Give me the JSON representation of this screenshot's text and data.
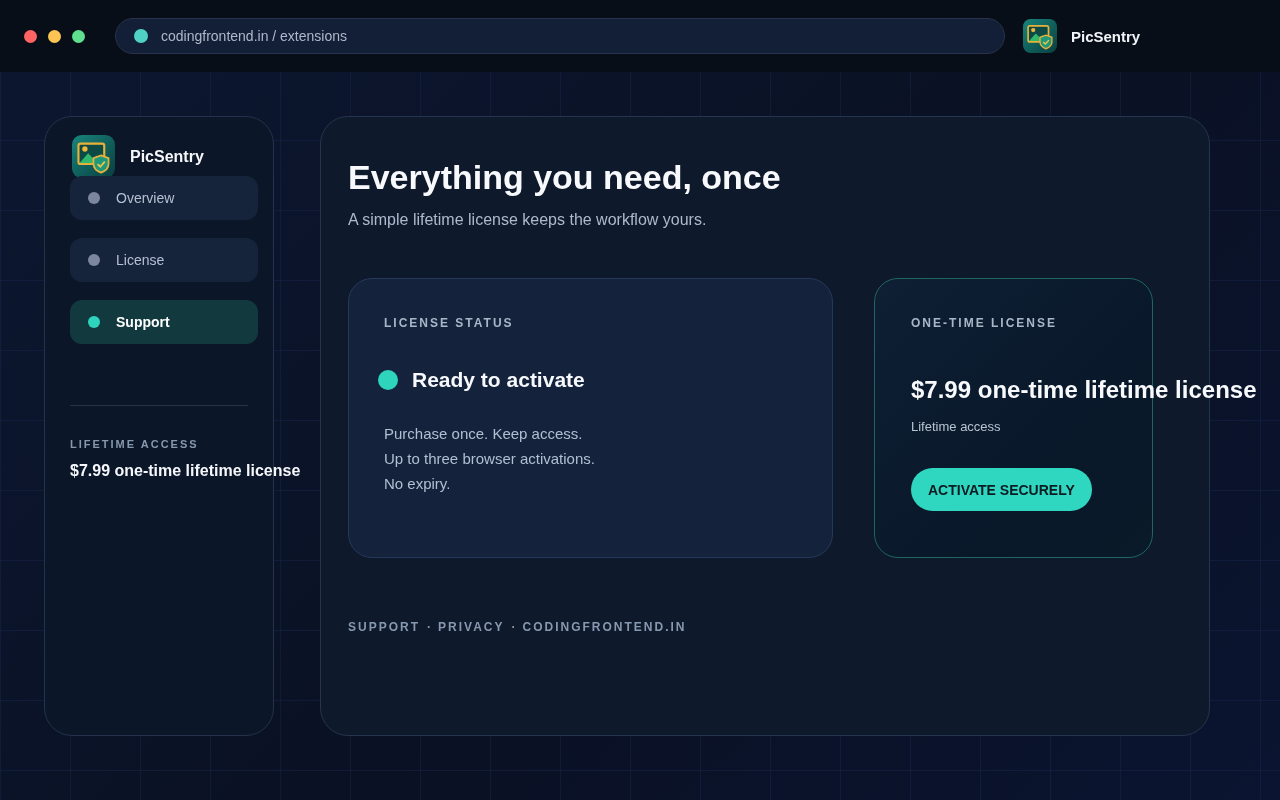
{
  "browser": {
    "window_controls": [
      {
        "color": "#fe6464"
      },
      {
        "color": "#fdc453"
      },
      {
        "color": "#5fe08f"
      }
    ],
    "address": "codingfrontend.in / extensions",
    "app_name": "PicSentry"
  },
  "sidebar": {
    "brand": "PicSentry",
    "items": [
      {
        "label": "Overview",
        "selected": false
      },
      {
        "label": "License",
        "selected": false
      },
      {
        "label": "Support",
        "selected": true
      }
    ],
    "section_label": "LIFETIME ACCESS",
    "price": "$7.99 one-time lifetime license"
  },
  "main": {
    "title": "Everything you need, once",
    "subtitle": "A simple lifetime license keeps the workflow yours.",
    "status_card": {
      "label": "LICENSE STATUS",
      "status": "Ready to activate",
      "lines": [
        "Purchase once. Keep access.",
        "Up to three browser activations.",
        "No expiry."
      ]
    },
    "offer_card": {
      "label": "ONE-TIME LICENSE",
      "price": "$7.99 one-time lifetime license",
      "note": "Lifetime access",
      "button": "ACTIVATE SECURELY"
    },
    "footer": {
      "links": [
        "SUPPORT",
        "PRIVACY",
        "CODINGFRONTEND.IN"
      ],
      "separator": "·"
    }
  }
}
